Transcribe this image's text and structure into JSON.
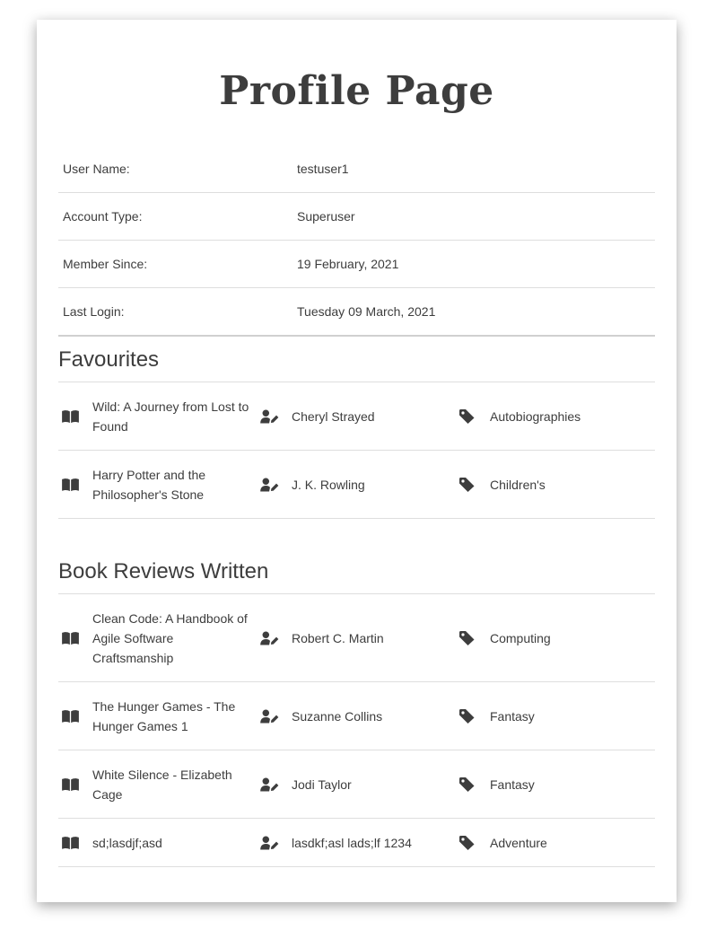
{
  "page": {
    "title": "Profile Page"
  },
  "profile": {
    "rows": [
      {
        "label": "User Name:",
        "value": "testuser1"
      },
      {
        "label": "Account Type:",
        "value": "Superuser"
      },
      {
        "label": "Member Since:",
        "value": "19 February, 2021"
      },
      {
        "label": "Last Login:",
        "value": "Tuesday 09 March, 2021"
      }
    ]
  },
  "favourites": {
    "heading": "Favourites",
    "items": [
      {
        "title": "Wild: A Journey from Lost to Found",
        "author": "Cheryl Strayed",
        "genre": "Autobiographies"
      },
      {
        "title": "Harry Potter and the Philosopher's Stone",
        "author": "J. K. Rowling",
        "genre": "Children's"
      }
    ]
  },
  "reviews": {
    "heading": "Book Reviews Written",
    "items": [
      {
        "title": "Clean Code: A Handbook of Agile Software Craftsmanship",
        "author": "Robert C. Martin",
        "genre": "Computing"
      },
      {
        "title": "The Hunger Games - The Hunger Games 1",
        "author": "Suzanne Collins",
        "genre": "Fantasy"
      },
      {
        "title": "White Silence - Elizabeth Cage",
        "author": "Jodi Taylor",
        "genre": "Fantasy"
      },
      {
        "title": "sd;lasdjf;asd",
        "author": "lasdkf;asl lads;lf 1234",
        "genre": "Adventure"
      }
    ]
  },
  "icons": {
    "book": "book-open-icon",
    "author": "user-edit-icon",
    "genre": "tag-icon"
  },
  "colors": {
    "text": "#3d3d3d",
    "divider": "#dedede"
  }
}
